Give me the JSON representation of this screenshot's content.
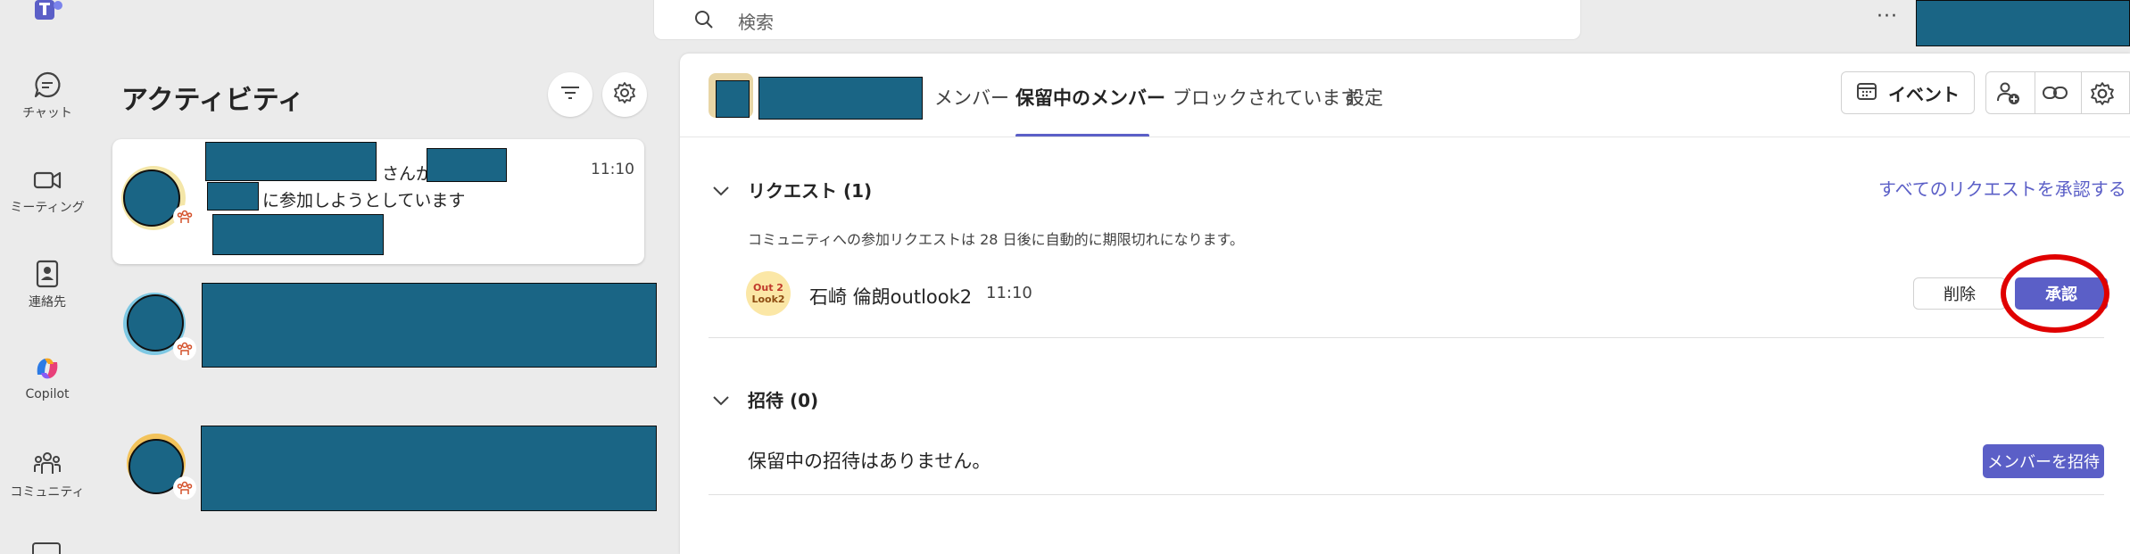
{
  "rail": {
    "items": [
      {
        "label": "チャット",
        "icon": "chat-icon"
      },
      {
        "label": "ミーティング",
        "icon": "video-icon"
      },
      {
        "label": "連絡先",
        "icon": "contacts-icon"
      },
      {
        "label": "Copilot",
        "icon": "copilot-icon"
      },
      {
        "label": "コミュニティ",
        "icon": "community-icon"
      }
    ]
  },
  "topbar": {
    "search_placeholder": "検索",
    "more_label": "···"
  },
  "activity": {
    "title": "アクティビティ",
    "items": [
      {
        "text_part1": "さんが",
        "text_part2": "に参加しようとしています",
        "time": "11:10"
      }
    ]
  },
  "community": {
    "tabs": [
      {
        "label": "メンバー",
        "active": false
      },
      {
        "label": "保留中のメンバー",
        "active": true
      },
      {
        "label": "ブロックされています",
        "active": false
      },
      {
        "label": "設定",
        "active": false
      }
    ],
    "event_button": "イベント"
  },
  "requests": {
    "header": "リクエスト (1)",
    "approve_all": "すべてのリクエストを承認する",
    "note": "コミュニティへの参加リクエストは 28 日後に自動的に期限切れになります。",
    "items": [
      {
        "avatar_line1": "Out 2",
        "avatar_line2": "Look2",
        "name": "石崎 倫朗outlook2",
        "time": "11:10",
        "delete_label": "削除",
        "approve_label": "承認"
      }
    ]
  },
  "invites": {
    "header": "招待 (0)",
    "empty_text": "保留中の招待はありません。",
    "invite_button": "メンバーを招待"
  },
  "colors": {
    "accent": "#5b5fc7",
    "redaction": "#1a6585",
    "highlight": "#e00000"
  }
}
